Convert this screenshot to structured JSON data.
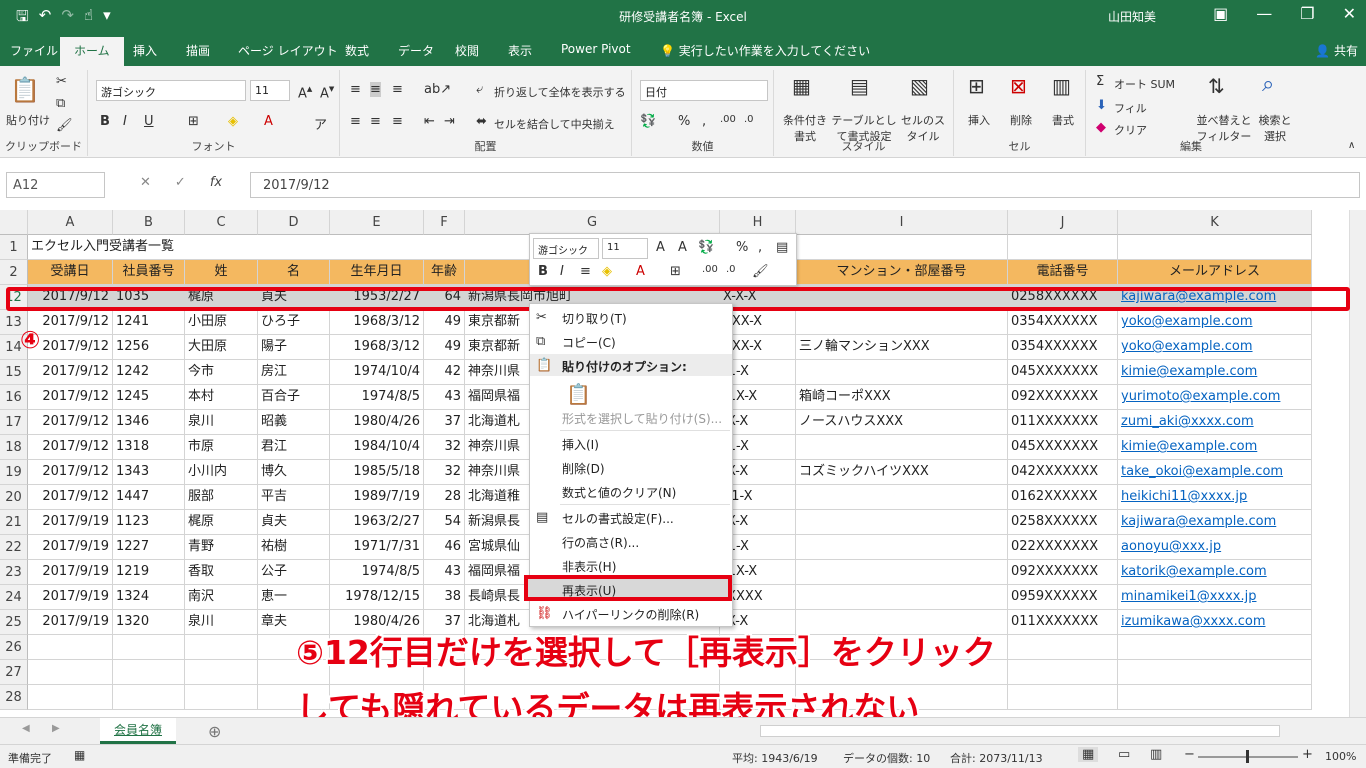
{
  "window": {
    "title": "研修受講者名簿 - Excel",
    "user": "山田知美",
    "share": "共有"
  },
  "tabs": [
    "ファイル",
    "ホーム",
    "挿入",
    "描画",
    "ページ レイアウト",
    "数式",
    "データ",
    "校閲",
    "表示",
    "Power Pivot",
    "実行したい作業を入力してください"
  ],
  "ribbon": {
    "paste": "貼り付け",
    "clipboard": "クリップボード",
    "font_name": "游ゴシック",
    "font_size": "11",
    "font_group": "フォント",
    "wrap": "折り返して全体を表示する",
    "merge": "セルを結合して中央揃え",
    "align_group": "配置",
    "number_format": "日付",
    "number_group": "数値",
    "cond": "条件付き書式",
    "table": "テーブルとして書式設定",
    "cellstyle": "セルのスタイル",
    "style_group": "スタイル",
    "insert": "挿入",
    "delete": "削除",
    "format": "書式",
    "cell_group": "セル",
    "autosum": "オート SUM",
    "fill": "フィル",
    "clear": "クリア",
    "sort": "並べ替えとフィルター",
    "find": "検索と選択",
    "edit_group": "編集"
  },
  "formula": {
    "namebox": "A12",
    "value": "2017/9/12"
  },
  "columns": [
    "A",
    "B",
    "C",
    "D",
    "E",
    "F",
    "G",
    "H",
    "I",
    "J",
    "K"
  ],
  "row1_title": "エクセル入門受講者一覧",
  "headers": [
    "受講日",
    "社員番号",
    "姓",
    "名",
    "生年月日",
    "年齢",
    "",
    "",
    "マンション・部屋番号",
    "電話番号",
    "メールアドレス"
  ],
  "rows": [
    [
      "12",
      "2017/9/12",
      "1035",
      "梶原",
      "貞夫",
      "1953/2/27",
      "64",
      "新潟県長岡市旭町",
      "X-X-X",
      "",
      "0258XXXXXX",
      "kajiwara@example.com"
    ],
    [
      "13",
      "2017/9/12",
      "1241",
      "小田原",
      "ひろ子",
      "1968/3/12",
      "49",
      "東京都新",
      "XXX-X",
      "",
      "0354XXXXXX",
      "yoko@example.com"
    ],
    [
      "14",
      "2017/9/12",
      "1256",
      "大田原",
      "陽子",
      "1968/3/12",
      "49",
      "東京都新",
      "XXX-X",
      "三ノ輪マンションXXX",
      "0354XXXXXX",
      "yoko@example.com"
    ],
    [
      "15",
      "2017/9/12",
      "1242",
      "今市",
      "房江",
      "1974/10/4",
      "42",
      "神奈川県",
      "-1-X",
      "",
      "045XXXXXXX",
      "kimie@example.com"
    ],
    [
      "16",
      "2017/9/12",
      "1245",
      "本村",
      "百合子",
      "1974/8/5",
      "43",
      "福岡県福",
      "-1X-X",
      "箱崎コーポXXX",
      "092XXXXXXX",
      "yurimoto@example.com"
    ],
    [
      "17",
      "2017/9/12",
      "1346",
      "泉川",
      "昭義",
      "1980/4/26",
      "37",
      "北海道札",
      "-X-X",
      "ノースハウスXXX",
      "011XXXXXXX",
      "zumi_aki@xxxx.com"
    ],
    [
      "18",
      "2017/9/12",
      "1318",
      "市原",
      "君江",
      "1984/10/4",
      "32",
      "神奈川県",
      "-1-X",
      "",
      "045XXXXXXX",
      "kimie@example.com"
    ],
    [
      "19",
      "2017/9/12",
      "1343",
      "小川内",
      "博久",
      "1985/5/18",
      "32",
      "神奈川県",
      "-X-X",
      "コズミックハイツXXX",
      "042XXXXXXX",
      "take_okoi@example.com"
    ],
    [
      "20",
      "2017/9/12",
      "1447",
      "服部",
      "平吉",
      "1989/7/19",
      "28",
      "北海道稚",
      "01-X",
      "",
      "0162XXXXXX",
      "heikichi11@xxxx.jp"
    ],
    [
      "21",
      "2017/9/19",
      "1123",
      "梶原",
      "貞夫",
      "1963/2/27",
      "54",
      "新潟県長",
      "-X-X",
      "",
      "0258XXXXXX",
      "kajiwara@example.com"
    ],
    [
      "22",
      "2017/9/19",
      "1227",
      "青野",
      "祐樹",
      "1971/7/31",
      "46",
      "宮城県仙",
      "-1-X",
      "",
      "022XXXXXXX",
      "aonoyu@xxx.jp"
    ],
    [
      "23",
      "2017/9/19",
      "1219",
      "香取",
      "公子",
      "1974/8/5",
      "43",
      "福岡県福",
      "-1X-X",
      "",
      "092XXXXXXX",
      "katorik@example.com"
    ],
    [
      "24",
      "2017/9/19",
      "1324",
      "南沢",
      "恵一",
      "1978/12/15",
      "38",
      "長崎県長",
      "-XXXX",
      "",
      "0959XXXXXX",
      "minamikei1@xxxx.jp"
    ],
    [
      "25",
      "2017/9/19",
      "1320",
      "泉川",
      "章夫",
      "1980/4/26",
      "37",
      "北海道札",
      "-X-X",
      "",
      "011XXXXXXX",
      "izumikawa@xxxx.com"
    ]
  ],
  "empty_rows": [
    "26",
    "27",
    "28"
  ],
  "mini_toolbar": {
    "font": "游ゴシック",
    "size": "11"
  },
  "context_menu": {
    "cut": "切り取り(T)",
    "copy": "コピー(C)",
    "paste_options": "貼り付けのオプション:",
    "paste_special": "形式を選択して貼り付け(S)...",
    "insert": "挿入(I)",
    "delete": "削除(D)",
    "clear": "数式と値のクリア(N)",
    "format": "セルの書式設定(F)...",
    "row_height": "行の高さ(R)...",
    "hide": "非表示(H)",
    "unhide": "再表示(U)",
    "remove_link": "ハイパーリンクの削除(R)"
  },
  "annotation": {
    "step4": "④",
    "line1": "⑤12行目だけを選択して［再表示］をクリック",
    "line2": "しても隠れているデータは再表示されない"
  },
  "sheet_tab": "会員名簿",
  "status": {
    "ready": "準備完了",
    "average": "平均: 1943/6/19",
    "count": "データの個数: 10",
    "sum": "合計: 2073/11/13",
    "zoom": "100%"
  },
  "colors": {
    "excel_green": "#217346",
    "header_fill": "#f4b860",
    "highlight": "#e60012"
  }
}
